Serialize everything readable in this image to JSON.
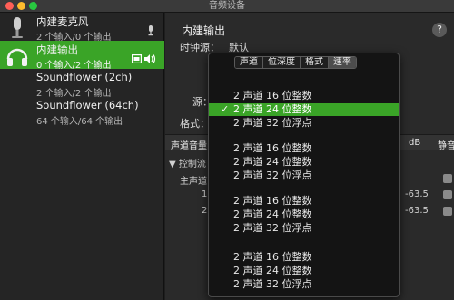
{
  "window": {
    "title": "音频设备"
  },
  "sidebar": {
    "devices": [
      {
        "name": "内建麦克风",
        "sub": "2 个输入/0 个输出"
      },
      {
        "name": "内建输出",
        "sub": "0 个输入/2 个输出"
      },
      {
        "name": "Soundflower (2ch)",
        "sub": "2 个输入/2 个输出"
      },
      {
        "name": "Soundflower (64ch)",
        "sub": "64 个输入/64 个输出"
      }
    ]
  },
  "main": {
    "title": "内建输出",
    "help": "?",
    "clock_label": "时钟源：",
    "clock_value": "默认",
    "source_label": "源：",
    "format_label": "格式：",
    "volume_header": {
      "col1": "声道音量",
      "db": "dB",
      "mute": "静音"
    },
    "tree": [
      {
        "label": "▼ 控制流"
      },
      {
        "label": "主声道"
      },
      {
        "label": "1",
        "db": "-63.5"
      },
      {
        "label": "2",
        "db": "-63.5"
      }
    ]
  },
  "popup": {
    "tabs": [
      "声道",
      "位深度",
      "格式",
      "速率"
    ],
    "active_tab": "速率",
    "selected_option_index": 1,
    "options": [
      "2 声道 16 位整数",
      "2 声道 24 位整数",
      "2 声道 32 位浮点",
      "2 声道 16 位整数",
      "2 声道 24 位整数",
      "2 声道 32 位浮点",
      "2 声道 16 位整数",
      "2 声道 24 位整数",
      "2 声道 32 位浮点",
      "2 声道 16 位整数",
      "2 声道 24 位整数",
      "2 声道 32 位浮点"
    ],
    "check_mark": "✓"
  },
  "colors": {
    "selection": "#3aa427",
    "popup_bg": "#141414",
    "sidebar_bg": "#252525"
  },
  "icons": [
    "microphone-icon",
    "headphones-icon",
    "screen-output-icon",
    "speaker-icon",
    "mic-small-icon",
    "help-icon",
    "checkmark-icon"
  ]
}
